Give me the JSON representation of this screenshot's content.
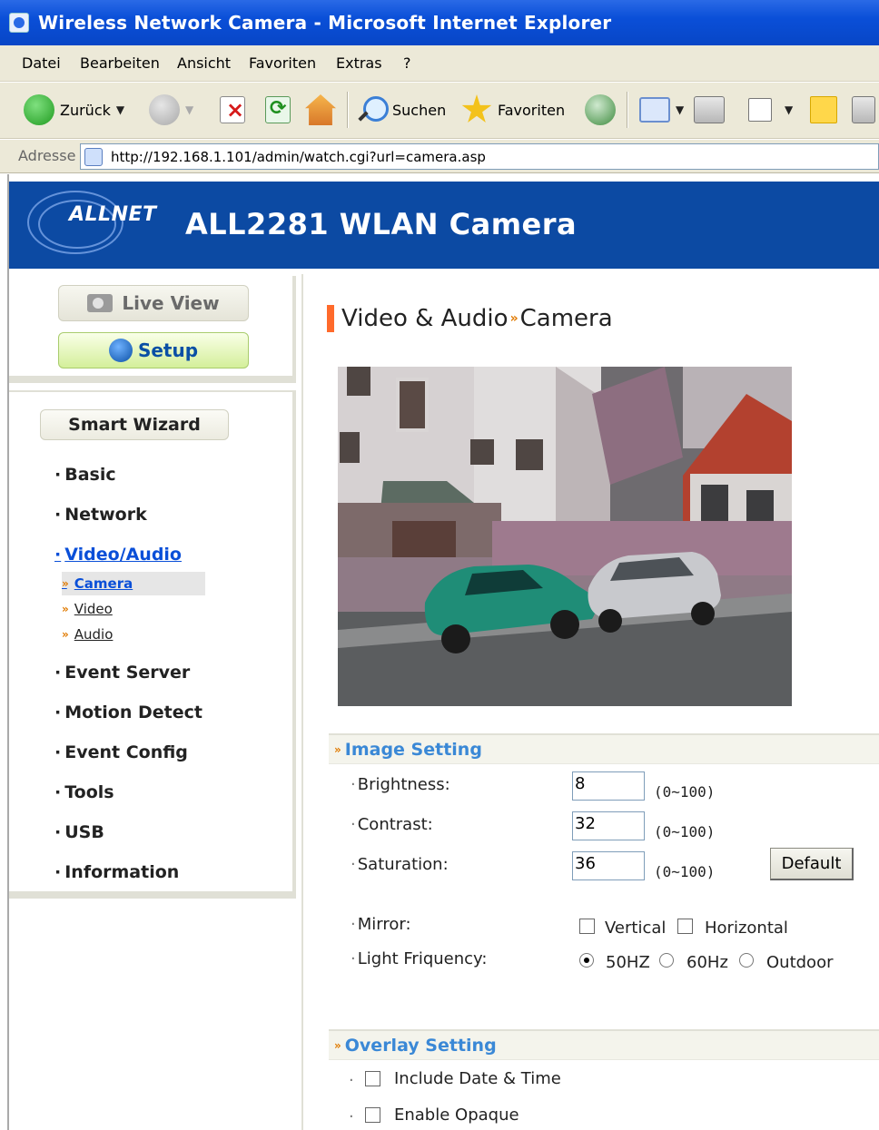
{
  "window": {
    "title": "Wireless Network Camera - Microsoft Internet Explorer"
  },
  "menu": [
    "Datei",
    "Bearbeiten",
    "Ansicht",
    "Favoriten",
    "Extras",
    "?"
  ],
  "toolbar": {
    "back_label": "Zurück",
    "search_label": "Suchen",
    "favorites_label": "Favoriten"
  },
  "address": {
    "label": "Adresse",
    "url": "http://192.168.1.101/admin/watch.cgi?url=camera.asp"
  },
  "header": {
    "brand": "ALLNET",
    "product": "ALL2281 WLAN Camera"
  },
  "nav": {
    "live_view": "Live View",
    "setup": "Setup",
    "smart_wizard": "Smart Wizard",
    "items": {
      "basic": "Basic",
      "network": "Network",
      "video_audio": "Video/Audio",
      "event_server": "Event Server",
      "motion_detect": "Motion Detect",
      "event_config": "Event Config",
      "tools": "Tools",
      "usb": "USB",
      "information": "Information"
    },
    "subitems": {
      "camera": "Camera",
      "video": "Video",
      "audio": "Audio"
    }
  },
  "main": {
    "title_section": "Video & Audio",
    "title_sep": "»",
    "title_page": "Camera",
    "image_setting": {
      "heading": "Image Setting",
      "brightness": {
        "label": "Brightness:",
        "value": "8",
        "range": "(0~100)"
      },
      "contrast": {
        "label": "Contrast:",
        "value": "32",
        "range": "(0~100)"
      },
      "saturation": {
        "label": "Saturation:",
        "value": "36",
        "range": "(0~100)"
      },
      "default_label": "Default",
      "mirror": {
        "label": "Mirror:",
        "vertical": "Vertical",
        "horizontal": "Horizontal"
      },
      "light_frequency": {
        "label": "Light Friquency:",
        "options": [
          "50HZ",
          "60Hz",
          "Outdoor"
        ],
        "selected": "50HZ"
      }
    },
    "overlay_setting": {
      "heading": "Overlay Setting",
      "include_date_time": "Include Date & Time",
      "enable_opaque": "Enable Opaque"
    }
  }
}
